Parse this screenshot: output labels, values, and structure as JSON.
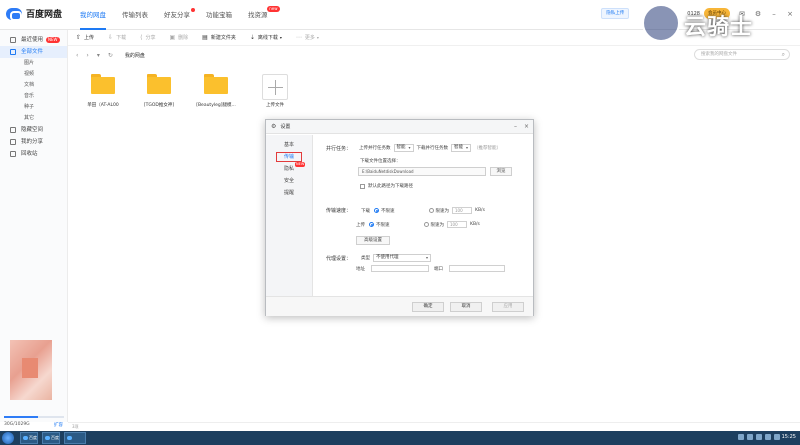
{
  "app": {
    "logo_text": "百度网盘"
  },
  "nav": [
    {
      "label": "我的网盘",
      "active": true
    },
    {
      "label": "传输列表"
    },
    {
      "label": "好友分享",
      "dot": true
    },
    {
      "label": "功能宝箱"
    },
    {
      "label": "找资源",
      "badge": "new"
    }
  ],
  "topright": {
    "btn1": "隐私上传",
    "user": "0128",
    "vip": "会员中心"
  },
  "watermark": {
    "text": "云骑士"
  },
  "sidebar": {
    "items": [
      {
        "label": "最近使用",
        "badge": "NEW"
      },
      {
        "label": "全部文件",
        "active": true
      }
    ],
    "sub": [
      "图片",
      "视频",
      "文档",
      "音乐",
      "种子",
      "其它"
    ],
    "bottom": [
      "隐藏空间",
      "我的分享",
      "回收站"
    ],
    "quota": "30G/1029G",
    "quota_fraction": 0.56,
    "expand": "扩容"
  },
  "toolbar": [
    {
      "label": "上传",
      "glyph": "⇧"
    },
    {
      "label": "下载",
      "glyph": "⇩",
      "disabled": true
    },
    {
      "label": "分享",
      "glyph": "⟨",
      "disabled": true
    },
    {
      "label": "删除",
      "glyph": "▣",
      "disabled": true
    },
    {
      "label": "新建文件夹",
      "glyph": "▤"
    },
    {
      "label": "离线下载",
      "glyph": "⇣"
    },
    {
      "label": "更多",
      "glyph": "⋯",
      "disabled": true
    }
  ],
  "path": {
    "crumb": "我的网盘",
    "search_placeholder": "搜索我的网盘文件"
  },
  "files": [
    {
      "name": "单田（AT-AL00"
    },
    {
      "name": "[TGOD推女神]"
    },
    {
      "name": "[Beautyleg]腿模..."
    }
  ],
  "upload": {
    "label": "上传文件"
  },
  "dialog": {
    "title": "设置",
    "menu": [
      "基本",
      "传输",
      "隐私",
      "安全",
      "提醒"
    ],
    "menu_new": "NEW",
    "tasks_label": "并行任务：",
    "upload_tasks": "上传并行任务数",
    "upload_value": "智能",
    "download_tasks": "下载并行任务数",
    "download_value": "智能",
    "hint": "（推荐智能）",
    "location_label": "下载文件位置选择：",
    "location_path": "E:\\BaiduNetdiskDownload",
    "browse": "浏览",
    "default_path": "默认此路径为下载路径",
    "speed_label": "传输速度：",
    "download": "下载",
    "upload": "上传",
    "no_limit": "不限速",
    "limit": "限速为",
    "speed_unit": "KB/s",
    "limit_value": "100",
    "advanced": "高级设置",
    "proxy_label": "代理设置：",
    "type": "类型",
    "proxy_value": "不使用代理",
    "address": "地址",
    "port": "端口",
    "ok": "确定",
    "cancel": "取消",
    "apply": "应用"
  },
  "status": {
    "text": "3项"
  },
  "taskbar": {
    "task1": "百度",
    "task2": "百度",
    "clock": "15:25"
  }
}
